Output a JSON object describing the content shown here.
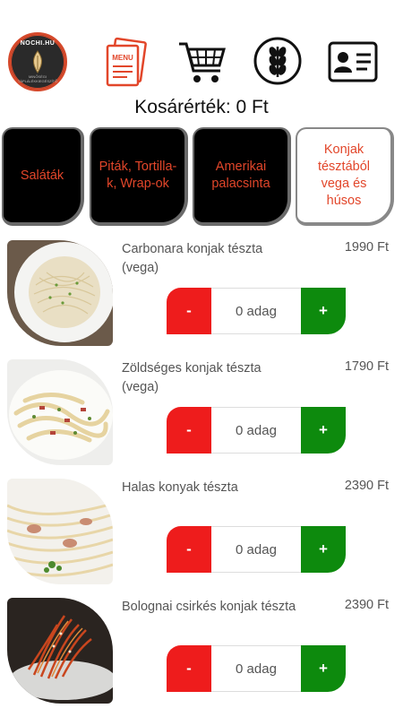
{
  "header": {
    "logo_text": "NOCHI.HU",
    "logo_subtext": "MINŐSÉGI TÁPLÁLÉKKIEGÉSZÍTŐ",
    "menu_icon_label": "MENU"
  },
  "cart": {
    "total_text": "Kosárérték: 0 Ft"
  },
  "tabs": [
    {
      "label": "Saláták"
    },
    {
      "label": "Piták, Tortilla-k, Wrap-ok"
    },
    {
      "label": "Amerikai palacsinta"
    },
    {
      "label": "Konjak tésztából vega és húsos"
    }
  ],
  "items": [
    {
      "name": "Carbonara konjak tészta (vega)",
      "price": "1990 Ft",
      "qty": "0 adag",
      "minus": "-",
      "plus": "+"
    },
    {
      "name": "Zöldséges konjak tészta (vega)",
      "price": "1790 Ft",
      "qty": "0 adag",
      "minus": "-",
      "plus": "+"
    },
    {
      "name": "Halas konyak tészta",
      "price": "2390 Ft",
      "qty": "0 adag",
      "minus": "-",
      "plus": "+"
    },
    {
      "name": "Bolognai csirkés konjak tészta",
      "price": "2390 Ft",
      "qty": "0 adag",
      "minus": "-",
      "plus": "+"
    }
  ],
  "colors": {
    "accent": "#e2462a",
    "minus": "#ee1c1c",
    "plus": "#0d8a0d"
  }
}
